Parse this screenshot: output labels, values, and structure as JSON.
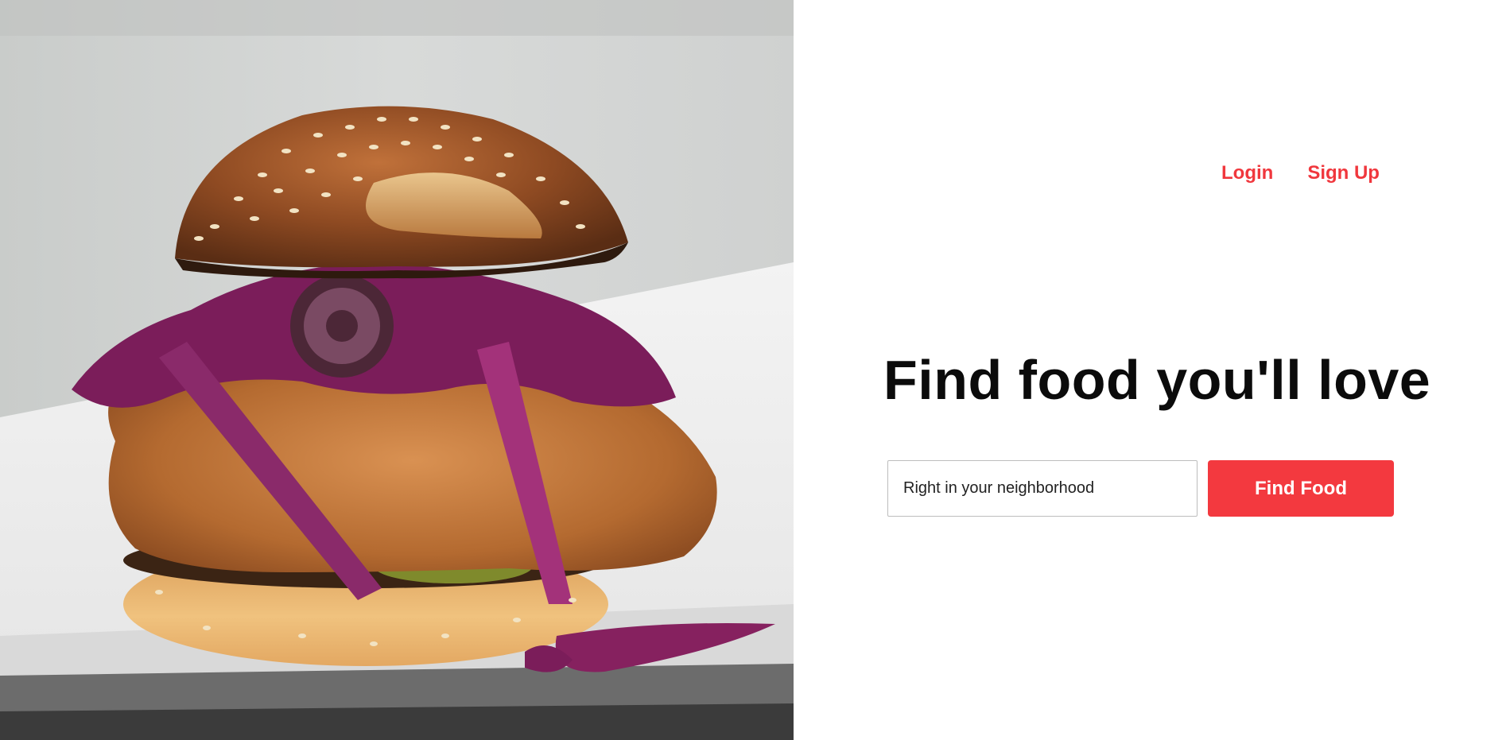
{
  "nav": {
    "login_label": "Login",
    "signup_label": "Sign Up"
  },
  "hero": {
    "headline": "Find food you'll love",
    "image_alt_icon": "burger-photo"
  },
  "search": {
    "placeholder": "Right in your neighborhood",
    "value": "",
    "button_label": "Find Food"
  },
  "colors": {
    "accent": "#f3393f",
    "text": "#0b0b0b",
    "background": "#ffffff"
  }
}
